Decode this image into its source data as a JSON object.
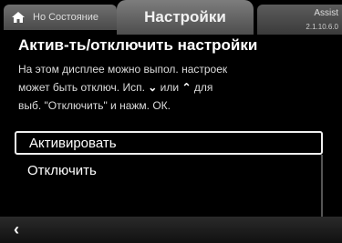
{
  "topbar": {
    "home_tab_label": "Но Состояние",
    "active_tab_label": "Настройки",
    "right_tab_label": "Assist",
    "right_tab_meta": "2.1.10.6.0"
  },
  "content": {
    "title": "Актив-ть/отключить настройки",
    "desc_line1": "На этом дисплее можно выпол. настроек",
    "desc_line2_prefix": "может быть отключ. Исп.",
    "desc_down_glyph": "⌄",
    "desc_line2_mid": "или",
    "desc_up_glyph": "⌃",
    "desc_line2_suffix": "для",
    "desc_line3": "выб. \"Отключить\" и нажм. ОК."
  },
  "options": [
    {
      "label": "Активировать",
      "selected": true
    },
    {
      "label": "Отключить",
      "selected": false
    }
  ],
  "bottombar": {
    "back_glyph": "‹"
  },
  "icons": {
    "home": "home-icon",
    "back": "back-icon"
  }
}
